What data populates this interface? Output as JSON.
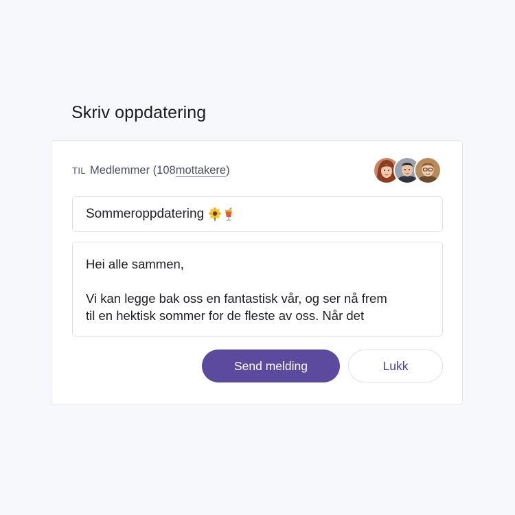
{
  "page": {
    "title": "Skriv oppdatering"
  },
  "recipients": {
    "to_label": "TIL",
    "group_text": "Medlemmer (108",
    "count_text": " mottakere",
    "close_paren": ")",
    "avatars": [
      {
        "name": "avatar-woman-red-hair"
      },
      {
        "name": "avatar-man-dark-hair"
      },
      {
        "name": "avatar-man-glasses"
      }
    ]
  },
  "subject": {
    "value": "Sommeroppdatering",
    "emoji_1": "sunflower-icon",
    "emoji_2": "tropical-drink-icon"
  },
  "message": {
    "line_1": "Hei alle sammen,",
    "line_2": "Vi kan legge bak oss en fantastisk vår, og ser nå frem",
    "line_3": "til en hektisk sommer for de fleste av oss. Når det"
  },
  "actions": {
    "send_label": "Send melding",
    "close_label": "Lukk"
  },
  "colors": {
    "accent": "#5b4a9e",
    "background": "#f7f8fc",
    "card": "#ffffff",
    "border": "#e0e3ea"
  }
}
